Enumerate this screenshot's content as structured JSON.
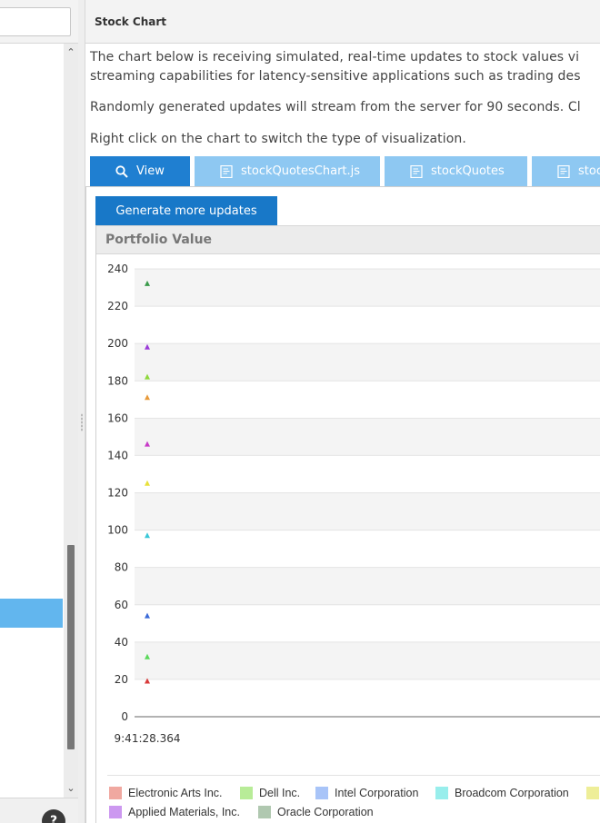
{
  "left_panel": {
    "search_placeholder": "",
    "help_label": "?"
  },
  "main": {
    "title": "Stock Chart",
    "description_line1": "The chart below is receiving simulated, real-time updates to stock values vi",
    "description_line2": "streaming capabilities for latency-sensitive applications such as trading des",
    "description_line3": "Randomly generated updates will stream from the server for 90 seconds. Cl",
    "description_line4": "Right click on the chart to switch the type of visualization."
  },
  "tabs": [
    {
      "label": "View",
      "icon": "search-icon"
    },
    {
      "label": "stockQuotesChart.js",
      "icon": "file-icon"
    },
    {
      "label": "stockQuotes",
      "icon": "file-icon"
    },
    {
      "label": "stoc",
      "icon": "file-icon"
    }
  ],
  "generate_button": "Generate more updates",
  "chart_panel": {
    "title": "Portfolio Value"
  },
  "colors": {
    "accent": "#1878c8",
    "tab_inactive": "#8ec8f2",
    "selection": "#62b6ee"
  },
  "legend": [
    {
      "name": "Electronic Arts Inc.",
      "color": "#f0a8a0"
    },
    {
      "name": "Dell Inc.",
      "color": "#b8ec98"
    },
    {
      "name": "Intel Corporation",
      "color": "#a8c4f8"
    },
    {
      "name": "Broadcom Corporation",
      "color": "#98eeec"
    },
    {
      "name": "",
      "color": "#eeee98"
    },
    {
      "name": "Applied Materials, Inc.",
      "color": "#cc98f0"
    },
    {
      "name": "Oracle Corporation",
      "color": "#b0c8b0"
    }
  ],
  "chart_data": {
    "type": "scatter",
    "title": "Portfolio Value",
    "xlabel": "",
    "ylabel": "",
    "ylim": [
      0,
      240
    ],
    "y_ticks": [
      0,
      20,
      40,
      60,
      80,
      100,
      120,
      140,
      160,
      180,
      200,
      220,
      240
    ],
    "x_ticks": [
      "9:41:28.364"
    ],
    "grid": true,
    "legend_position": "bottom",
    "points": [
      {
        "x": "9:41:28.364",
        "y": 232,
        "color": "#3a9a4a"
      },
      {
        "x": "9:41:28.364",
        "y": 198,
        "color": "#9a3ad8"
      },
      {
        "x": "9:41:28.364",
        "y": 182,
        "color": "#8ed83a"
      },
      {
        "x": "9:41:28.364",
        "y": 171,
        "color": "#e89a3a"
      },
      {
        "x": "9:41:28.364",
        "y": 146,
        "color": "#c83ac8"
      },
      {
        "x": "9:41:28.364",
        "y": 125,
        "color": "#e8e03a"
      },
      {
        "x": "9:41:28.364",
        "y": 97,
        "color": "#3ac8d8"
      },
      {
        "x": "9:41:28.364",
        "y": 54,
        "color": "#3a6ad8"
      },
      {
        "x": "9:41:28.364",
        "y": 32,
        "color": "#5ad85a"
      },
      {
        "x": "9:41:28.364",
        "y": 19,
        "color": "#d83a3a"
      }
    ]
  }
}
